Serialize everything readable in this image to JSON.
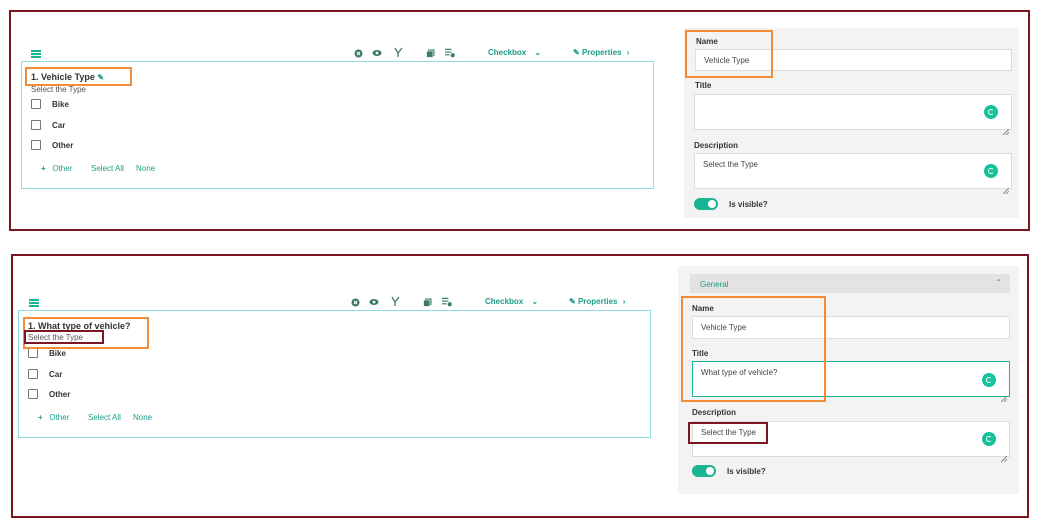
{
  "toolbar": {
    "question_type": "Checkbox",
    "properties_label": "Properties"
  },
  "top": {
    "question_title": "1. Vehicle Type",
    "description": "Select the Type",
    "choices": [
      "Bike",
      "Car",
      "Other"
    ],
    "add_other": "Other",
    "select_all": "Select All",
    "none": "None",
    "panel": {
      "name_label": "Name",
      "name_value": "Vehicle Type",
      "title_label": "Title",
      "title_value": "",
      "description_label": "Description",
      "description_value": "Select the Type",
      "visible_label": "Is visible?"
    }
  },
  "bottom": {
    "question_title": "1. What type of vehicle?",
    "description": "Select the Type",
    "choices": [
      "Bike",
      "Car",
      "Other"
    ],
    "add_other": "Other",
    "select_all": "Select All",
    "none": "None",
    "panel": {
      "section_label": "General",
      "name_label": "Name",
      "name_value": "Vehicle Type",
      "title_label": "Title",
      "title_value": "What type of vehicle?",
      "description_label": "Description",
      "description_value": "Select the Type",
      "visible_label": "Is visible?"
    }
  },
  "colors": {
    "accent": "#1ab394",
    "frame": "#7b1723",
    "highlight": "#f28c38"
  }
}
